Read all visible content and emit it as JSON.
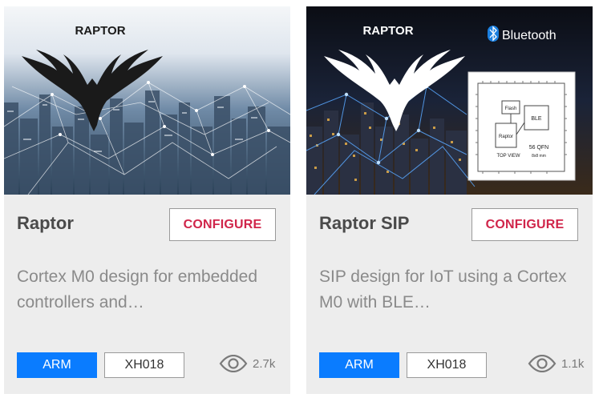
{
  "cards": [
    {
      "title": "Raptor",
      "configure_label": "CONFIGURE",
      "description": "Cortex M0 design for embedded controllers and…",
      "image_label": "RAPTOR",
      "tags": [
        "ARM",
        "XH018"
      ],
      "views": "2.7k"
    },
    {
      "title": "Raptor SIP",
      "configure_label": "CONFIGURE",
      "description": "SIP design for IoT using a Cortex M0 with BLE…",
      "image_label": "RAPTOR",
      "bluetooth_label": "Bluetooth",
      "diagram": {
        "flash": "Flash",
        "ble": "BLE",
        "raptor": "Raptor",
        "top_view": "TOP VIEW",
        "package": "56 QFN",
        "size": "8x8 mm"
      },
      "tags": [
        "ARM",
        "XH018"
      ],
      "views": "1.1k"
    }
  ],
  "colors": {
    "accent": "#d0254a",
    "tag_blue": "#0a7cff",
    "card_bg": "#ededed"
  },
  "icons": [
    "eye-icon",
    "bluetooth-icon",
    "eagle-silhouette"
  ]
}
